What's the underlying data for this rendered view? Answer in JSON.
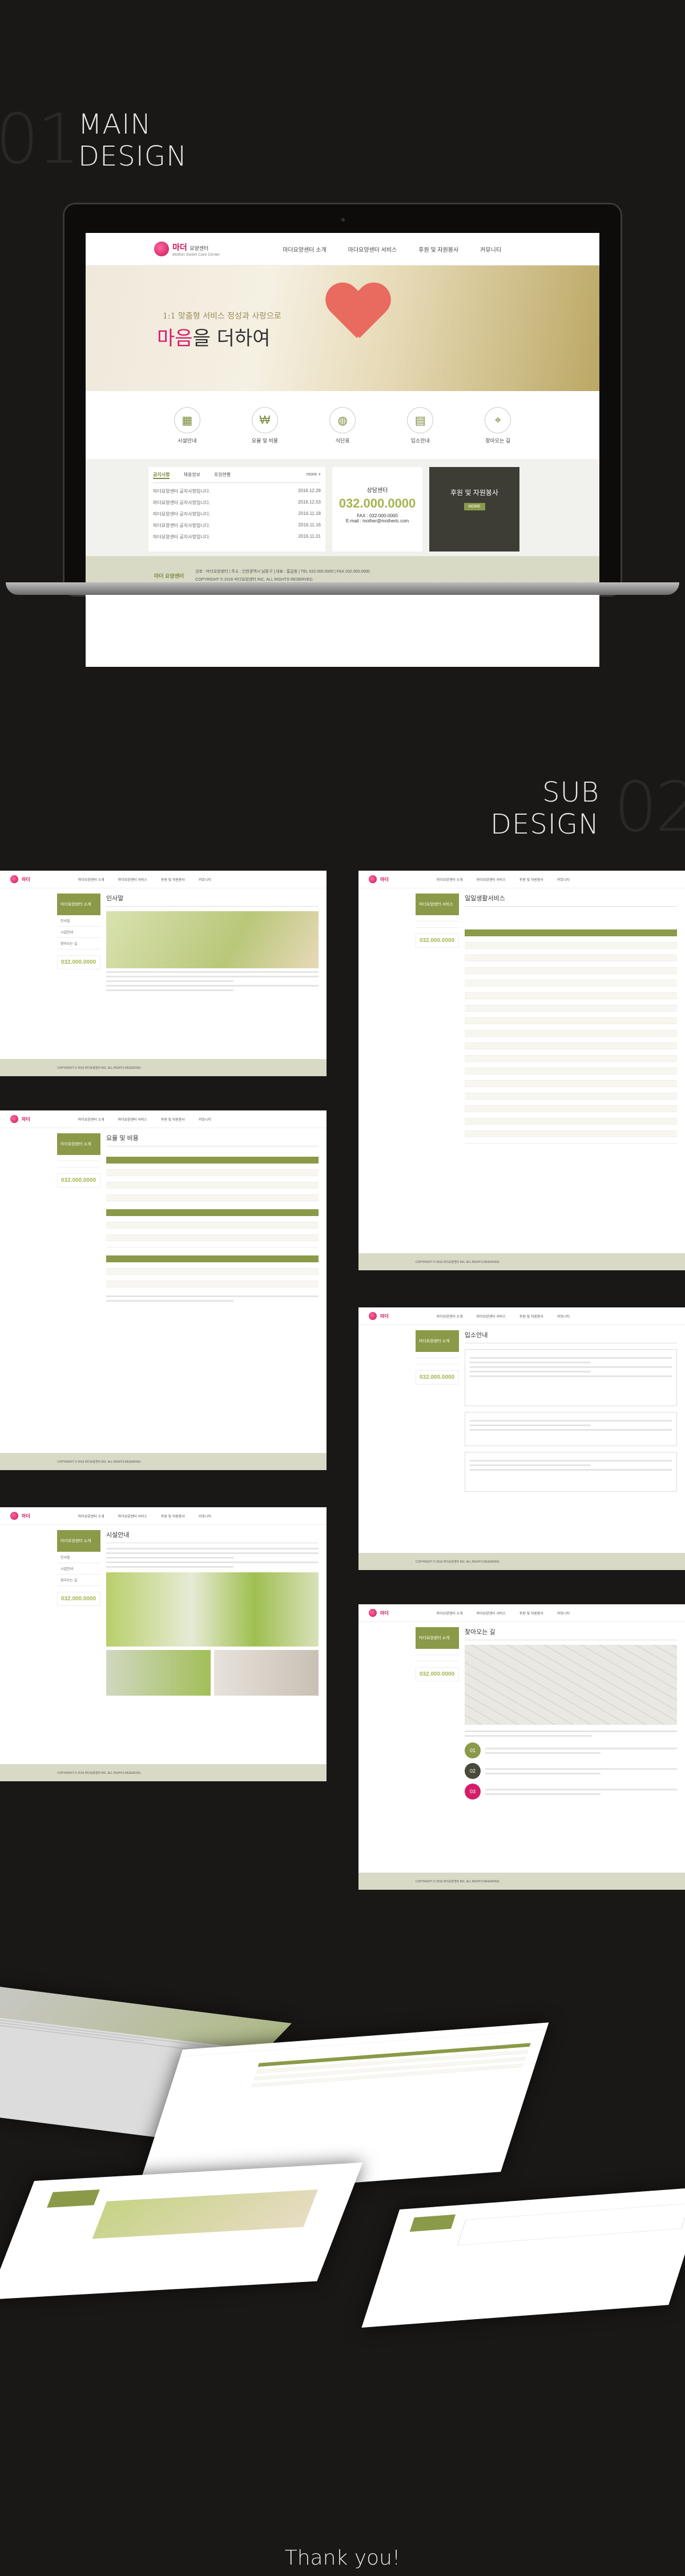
{
  "section1": {
    "num": "01",
    "line1": "MAIN",
    "line2": "DESIGN"
  },
  "section2": {
    "num": "02",
    "line1": "SUB",
    "line2": "DESIGN"
  },
  "main": {
    "logo": "마더",
    "logo_suffix": "요양센터",
    "logo_sub": "Mother Sweet Care Center",
    "nav": [
      "마더요양센터 소개",
      "마더요양센터 서비스",
      "후원 및 자원봉사",
      "커뮤니티"
    ],
    "hero_sub": "1:1 맞춤형 서비스 정성과 사랑으로",
    "hero_title_pink": "마음",
    "hero_title_rest": "을 더하여",
    "icons": [
      {
        "label": "시설안내",
        "icon": "building-icon"
      },
      {
        "label": "요율 및 비용",
        "icon": "money-icon"
      },
      {
        "label": "식단표",
        "icon": "meal-icon"
      },
      {
        "label": "입소안내",
        "icon": "clipboard-icon"
      },
      {
        "label": "찾아오는 길",
        "icon": "map-icon"
      }
    ],
    "board": {
      "tabs": [
        "공지사항",
        "채용정보",
        "후원현황"
      ],
      "more": "more +",
      "rows": [
        {
          "title": "마더요양센터 공지사항입니다.",
          "date": "2016.12.28"
        },
        {
          "title": "마더요양센터 공지사항입니다.",
          "date": "2016.12.03"
        },
        {
          "title": "마더요양센터 공지사항입니다.",
          "date": "2016.11.18"
        },
        {
          "title": "마더요양센터 공지사항입니다.",
          "date": "2016.11.16"
        },
        {
          "title": "마더요양센터 공지사항입니다.",
          "date": "2016.11.01"
        }
      ]
    },
    "consult": {
      "title": "상담센터",
      "phone": "032.000.0000",
      "fax": "FAX : 032-000-0000",
      "email": "E-mail : mother@motherlc.com"
    },
    "donate": {
      "title": "후원 및 자원봉사",
      "button": "MORE"
    },
    "footer": {
      "logo": "마더 요양센터",
      "text": "상호 : 마더요양센터 | 주소 : 인천광역시 남동구 | 대표 : 홍길동 | TEL 032.000.0000 | FAX 032.000.0000",
      "copy": "COPYRIGHT © 2016 마더요양센터 INC. ALL RIGHTS RESERVED."
    }
  },
  "subs": {
    "s1_title": "인사말",
    "s2_title": "일일생활서비스",
    "s3_title": "요율 및 비용",
    "s4_title": "입소안내",
    "s5_title": "시설안내",
    "s6_title": "찾아오는 길",
    "side_title": "마더요양센터 소개",
    "side_items": [
      "인사말",
      "시설안내",
      "찾아오는 길"
    ],
    "side_phone": "032.000.0000",
    "steps": [
      "01",
      "02",
      "03"
    ]
  },
  "thanks": "Thank you!"
}
